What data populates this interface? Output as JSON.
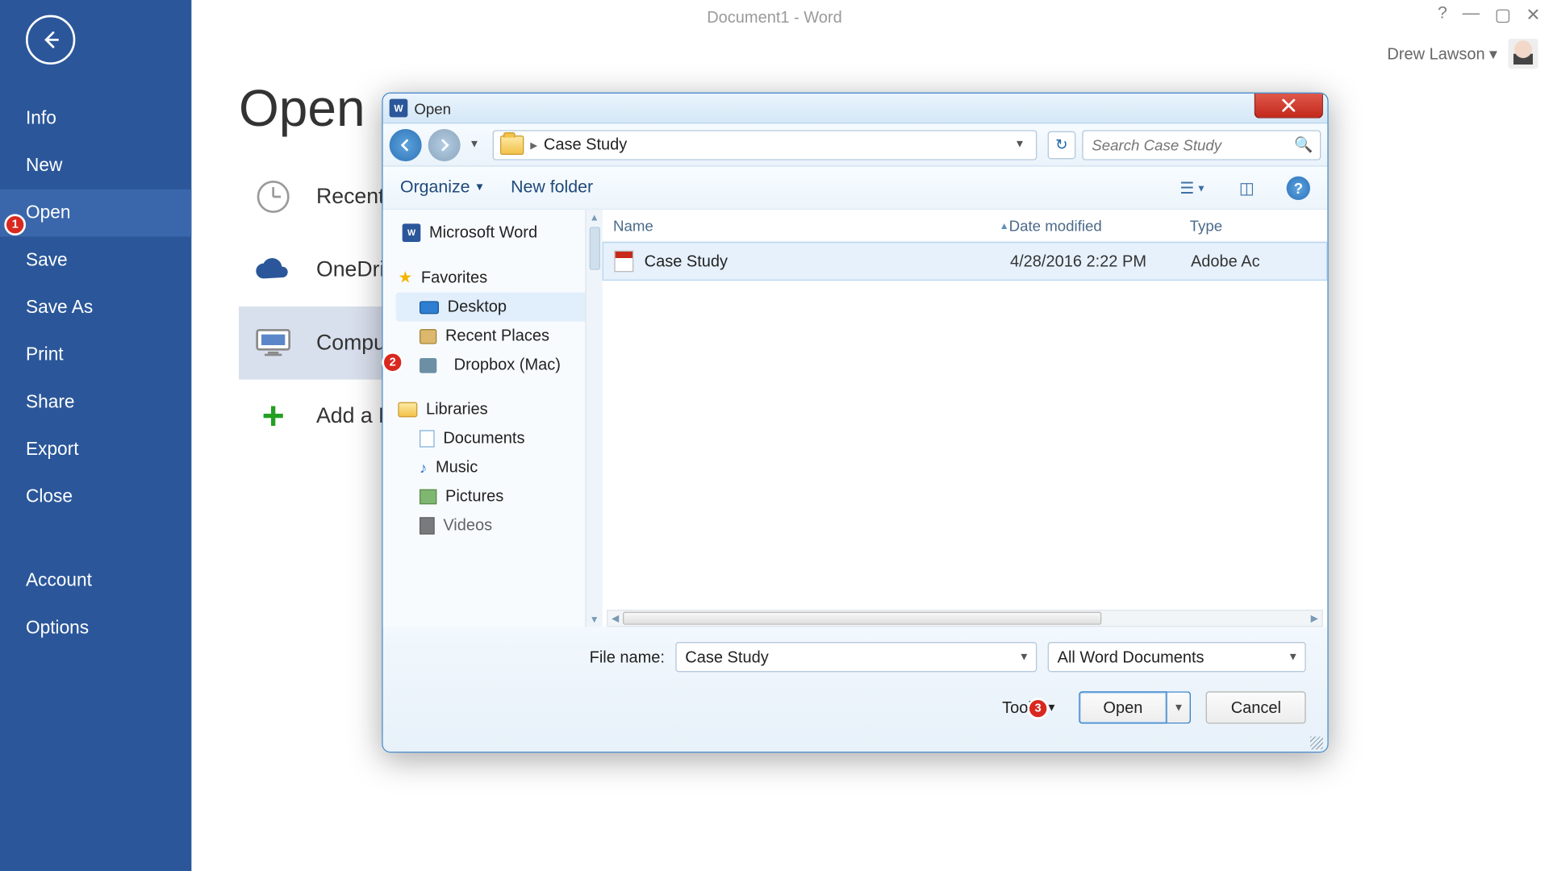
{
  "window": {
    "title": "Document1 - Word",
    "user_name": "Drew Lawson"
  },
  "backstage": {
    "page_title": "Open",
    "items": [
      "Info",
      "New",
      "Open",
      "Save",
      "Save As",
      "Print",
      "Share",
      "Export",
      "Close"
    ],
    "bottom_items": [
      "Account",
      "Options"
    ],
    "selected_index": 2
  },
  "places": {
    "items": [
      "Recent",
      "OneDrive",
      "Computer",
      "Add a Place"
    ],
    "selected_index": 2
  },
  "dialog": {
    "title": "Open",
    "breadcrumb": "Case Study",
    "search_placeholder": "Search Case Study",
    "toolbar": {
      "organize": "Organize",
      "new_folder": "New folder"
    },
    "nav_pane": {
      "top_item": "Microsoft Word",
      "favorites_label": "Favorites",
      "favorites": [
        "Desktop",
        "Recent Places",
        "Dropbox (Mac)"
      ],
      "favorites_selected_index": 0,
      "libraries_label": "Libraries",
      "libraries": [
        "Documents",
        "Music",
        "Pictures",
        "Videos"
      ]
    },
    "columns": {
      "name": "Name",
      "date": "Date modified",
      "type": "Type"
    },
    "files": [
      {
        "name": "Case Study",
        "date": "4/28/2016 2:22 PM",
        "type": "Adobe Ac"
      }
    ],
    "footer": {
      "file_name_label": "File name:",
      "file_name_value": "Case Study",
      "filter_value": "All Word Documents",
      "tools_label": "Tools",
      "open_label": "Open",
      "cancel_label": "Cancel"
    }
  },
  "callouts": {
    "c1": "1",
    "c2": "2",
    "c3": "3"
  }
}
